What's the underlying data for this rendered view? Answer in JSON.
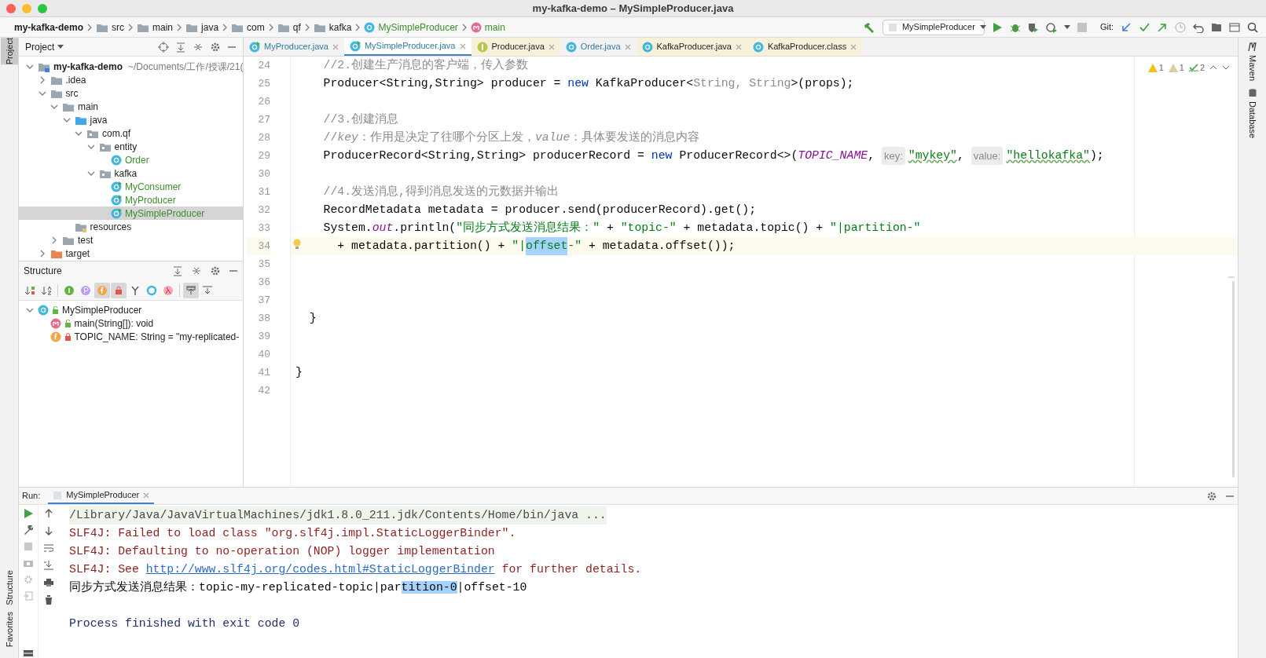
{
  "window": {
    "title": "my-kafka-demo – MySimpleProducer.java"
  },
  "breadcrumbs": [
    {
      "label": "my-kafka-demo",
      "kind": "project"
    },
    {
      "label": "src",
      "kind": "folder"
    },
    {
      "label": "main",
      "kind": "folder"
    },
    {
      "label": "java",
      "kind": "folder"
    },
    {
      "label": "com",
      "kind": "folder"
    },
    {
      "label": "qf",
      "kind": "folder"
    },
    {
      "label": "kafka",
      "kind": "folder"
    },
    {
      "label": "MySimpleProducer",
      "kind": "class"
    },
    {
      "label": "main",
      "kind": "method"
    }
  ],
  "toolbar": {
    "run_config": "MySimpleProducer",
    "git_label": "Git:"
  },
  "side_tabs_left": [
    {
      "label": "Project",
      "selected": true
    },
    {
      "label": "Structure",
      "selected": false
    },
    {
      "label": "Favorites",
      "selected": false
    }
  ],
  "side_tabs_right": [
    {
      "label": "Maven",
      "kind": "maven"
    },
    {
      "label": "Database",
      "kind": "database"
    }
  ],
  "project_panel": {
    "title": "Project",
    "tree": [
      {
        "label": "my-kafka-demo",
        "suffix": "~/Documents/工作/授课/21(",
        "kind": "module",
        "expanded": true,
        "selected": false,
        "children": [
          {
            "label": ".idea",
            "kind": "folder",
            "expanded": false,
            "selected": false
          },
          {
            "label": "src",
            "kind": "folder",
            "expanded": true,
            "selected": false,
            "children": [
              {
                "label": "main",
                "kind": "folder",
                "expanded": true,
                "selected": false,
                "children": [
                  {
                    "label": "java",
                    "kind": "source",
                    "expanded": true,
                    "selected": false,
                    "children": [
                      {
                        "label": "com.qf",
                        "kind": "package",
                        "expanded": true,
                        "selected": false,
                        "children": [
                          {
                            "label": "entity",
                            "kind": "package",
                            "expanded": true,
                            "selected": false,
                            "children": [
                              {
                                "label": "Order",
                                "kind": "class",
                                "selected": false
                              }
                            ]
                          },
                          {
                            "label": "kafka",
                            "kind": "package",
                            "expanded": true,
                            "selected": false,
                            "children": [
                              {
                                "label": "MyConsumer",
                                "kind": "runnable",
                                "selected": false
                              },
                              {
                                "label": "MyProducer",
                                "kind": "runnable",
                                "selected": false
                              },
                              {
                                "label": "MySimpleProducer",
                                "kind": "runnable",
                                "selected": true
                              }
                            ]
                          }
                        ]
                      }
                    ]
                  },
                  {
                    "label": "resources",
                    "kind": "resources",
                    "selected": false
                  }
                ]
              },
              {
                "label": "test",
                "kind": "folder",
                "expanded": false,
                "selected": false
              }
            ]
          },
          {
            "label": "target",
            "kind": "excluded",
            "expanded": false,
            "selected": false
          }
        ]
      }
    ]
  },
  "structure_panel": {
    "title": "Structure",
    "tools": [
      {
        "kind": "sort-visibility",
        "on": false
      },
      {
        "kind": "sort-alpha",
        "on": false
      },
      {
        "kind": "inherited",
        "on": false
      },
      {
        "kind": "properties",
        "on": false
      },
      {
        "kind": "fields",
        "on": true
      },
      {
        "kind": "non-public",
        "on": true
      },
      {
        "kind": "lambdas-merge",
        "on": false
      },
      {
        "kind": "anonymous",
        "on": false
      },
      {
        "kind": "lambdas",
        "on": false
      },
      {
        "kind": "autoscroll-to",
        "on": true
      },
      {
        "kind": "autoscroll-from",
        "on": false
      }
    ],
    "tree": [
      {
        "label": "MySimpleProducer",
        "kind": "class",
        "private": false,
        "expanded": true,
        "children": [
          {
            "label": "main(String[]): void",
            "kind": "method",
            "private": false
          },
          {
            "label": "TOPIC_NAME: String = \"my-replicated-",
            "kind": "field",
            "private": true
          }
        ]
      }
    ]
  },
  "editor_tabs": [
    {
      "label": "MyProducer.java",
      "kind": "runnable",
      "library": false,
      "selected": false
    },
    {
      "label": "MySimpleProducer.java",
      "kind": "runnable",
      "library": false,
      "selected": true
    },
    {
      "label": "Producer.java",
      "kind": "interface",
      "library": true,
      "selected": false
    },
    {
      "label": "Order.java",
      "kind": "class",
      "library": false,
      "selected": false
    },
    {
      "label": "KafkaProducer.java",
      "kind": "class",
      "library": true,
      "selected": false
    },
    {
      "label": "KafkaProducer.class",
      "kind": "class",
      "library": true,
      "selected": false
    }
  ],
  "inspections": [
    {
      "kind": "warning",
      "count": "1"
    },
    {
      "kind": "weak-warning",
      "count": "1"
    },
    {
      "kind": "typo",
      "count": "2"
    }
  ],
  "code_lines": [
    {
      "number": "24",
      "current": false,
      "tokens": [
        {
          "text": "    //2.创建生产消息的客户端，传入参数",
          "kind": "comment"
        }
      ]
    },
    {
      "number": "25",
      "current": false,
      "tokens": [
        {
          "text": "    Producer<String,String> producer = ",
          "kind": "plain"
        },
        {
          "text": "new",
          "kind": "keyword"
        },
        {
          "text": " KafkaProducer<",
          "kind": "plain"
        },
        {
          "text": "String, String",
          "kind": "generic"
        },
        {
          "text": ">(props);",
          "kind": "plain"
        }
      ]
    },
    {
      "number": "26",
      "current": false
    },
    {
      "number": "27",
      "current": false,
      "tokens": [
        {
          "text": "    //3.创建消息",
          "kind": "comment"
        }
      ]
    },
    {
      "number": "28",
      "current": false,
      "tokens": [
        {
          "text": "    //*key*：作用是决定了往哪个分区上发，*value*：具体要发送的消息内容",
          "kind": "comment"
        }
      ]
    },
    {
      "number": "29",
      "current": false,
      "tokens": [
        {
          "text": "    ProducerRecord<String,String> producerRecord = ",
          "kind": "plain"
        },
        {
          "text": "new",
          "kind": "keyword"
        },
        {
          "text": " ProducerRecord<>(",
          "kind": "plain"
        },
        {
          "text": "TOPIC_NAME",
          "kind": "static"
        },
        {
          "text": ", ",
          "kind": "plain"
        },
        {
          "text": "key:",
          "kind": "hint"
        },
        {
          "text": "\"mykey\"",
          "kind": "string-typo"
        },
        {
          "text": ", ",
          "kind": "plain"
        },
        {
          "text": "value:",
          "kind": "hint"
        },
        {
          "text": "\"hellokafka\"",
          "kind": "string-typo"
        },
        {
          "text": ");",
          "kind": "plain"
        }
      ]
    },
    {
      "number": "30",
      "current": false
    },
    {
      "number": "31",
      "current": false,
      "tokens": [
        {
          "text": "    //4.发送消息,得到消息发送的元数据并输出",
          "kind": "comment"
        }
      ]
    },
    {
      "number": "32",
      "current": false,
      "tokens": [
        {
          "text": "    RecordMetadata metadata = producer.send(producerRecord).get();",
          "kind": "plain"
        }
      ]
    },
    {
      "number": "33",
      "current": false,
      "tokens": [
        {
          "text": "    System.",
          "kind": "plain"
        },
        {
          "text": "out",
          "kind": "static"
        },
        {
          "text": ".println(",
          "kind": "plain"
        },
        {
          "text": "\"同步方式发送消息结果：\"",
          "kind": "string"
        },
        {
          "text": " + ",
          "kind": "plain"
        },
        {
          "text": "\"topic-\"",
          "kind": "string"
        },
        {
          "text": " + metadata.topic() + ",
          "kind": "plain"
        },
        {
          "text": "\"|partition-\"",
          "kind": "string"
        }
      ]
    },
    {
      "number": "34",
      "current": true,
      "tokens": [
        {
          "text": "      + metadata.partition() + ",
          "kind": "plain"
        },
        {
          "text": "\"|",
          "kind": "string"
        },
        {
          "text": "offset",
          "kind": "selected"
        },
        {
          "text": "-\"",
          "kind": "string"
        },
        {
          "text": " + metadata.offset());",
          "kind": "plain"
        }
      ]
    },
    {
      "number": "35",
      "current": false
    },
    {
      "number": "36",
      "current": false
    },
    {
      "number": "37",
      "current": false
    },
    {
      "number": "38",
      "current": false,
      "tokens": [
        {
          "text": "  }",
          "kind": "plain"
        }
      ]
    },
    {
      "number": "39",
      "current": false
    },
    {
      "number": "40",
      "current": false
    },
    {
      "number": "41",
      "current": false,
      "tokens": [
        {
          "text": "}",
          "kind": "plain"
        }
      ]
    },
    {
      "number": "42",
      "current": false
    }
  ],
  "run_panel": {
    "label": "Run:",
    "tab": "MySimpleProducer",
    "lines": [
      {
        "kind": "command",
        "parts": [
          {
            "text": "/Library/Java/JavaVirtualMachines/jdk1.8.0_211.jdk/Contents/Home/bin/java ...",
            "kind": "text"
          }
        ]
      },
      {
        "kind": "error",
        "parts": [
          {
            "text": "SLF4J: Failed to load class \"org.slf4j.impl.StaticLoggerBinder\".",
            "kind": "text"
          }
        ]
      },
      {
        "kind": "error",
        "parts": [
          {
            "text": "SLF4J: Defaulting to no-operation (NOP) logger implementation",
            "kind": "text"
          }
        ]
      },
      {
        "kind": "error",
        "parts": [
          {
            "text": "SLF4J: See ",
            "kind": "text"
          },
          {
            "text": "http://www.slf4j.org/codes.html#StaticLoggerBinder",
            "kind": "link"
          },
          {
            "text": " for further details.",
            "kind": "text"
          }
        ]
      },
      {
        "kind": "output",
        "parts": [
          {
            "text": "同步方式发送消息结果：topic-my-replicated-topic|par",
            "kind": "text"
          },
          {
            "text": "tition-0",
            "kind": "selected"
          },
          {
            "text": "|offset-10",
            "kind": "text"
          }
        ]
      },
      {
        "kind": "exit",
        "parts": [
          {
            "text": "Process finished with exit code 0",
            "kind": "text"
          }
        ]
      }
    ]
  }
}
